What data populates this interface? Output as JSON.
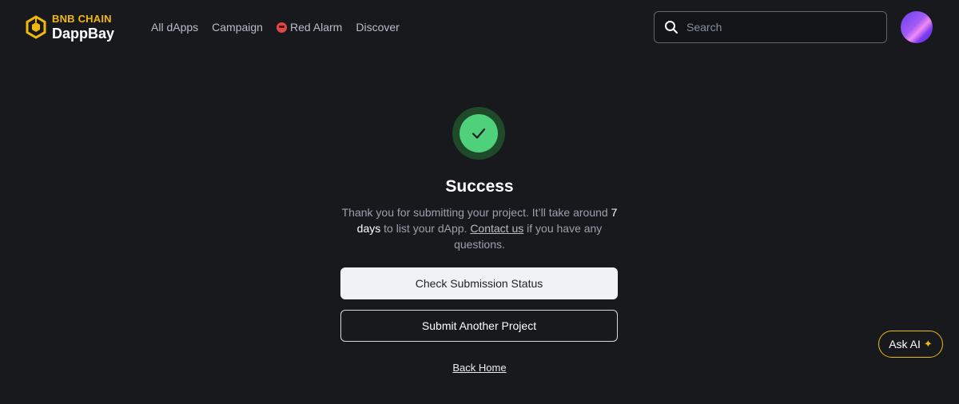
{
  "header": {
    "logo_top": "BNB CHAIN",
    "logo_bottom": "DappBay",
    "nav": [
      {
        "label": "All dApps"
      },
      {
        "label": "Campaign"
      },
      {
        "label": "Red Alarm",
        "icon": "red-alarm-icon"
      },
      {
        "label": "Discover"
      }
    ],
    "search_placeholder": "Search"
  },
  "main": {
    "title": "Success",
    "message_before": "Thank you for submitting your project. It’ll take around ",
    "message_days": "7 days",
    "message_middle": " to list your dApp. ",
    "contact_link": "Contact us",
    "message_after": " if you have any questions.",
    "primary_button": "Check Submission Status",
    "secondary_button": "Submit Another Project",
    "back_link": "Back Home"
  },
  "ask_ai": {
    "label": "Ask AI",
    "icon": "sparkle-icon"
  },
  "colors": {
    "background": "#18191d",
    "brand": "#f0b90b",
    "success": "#4ed17a"
  }
}
